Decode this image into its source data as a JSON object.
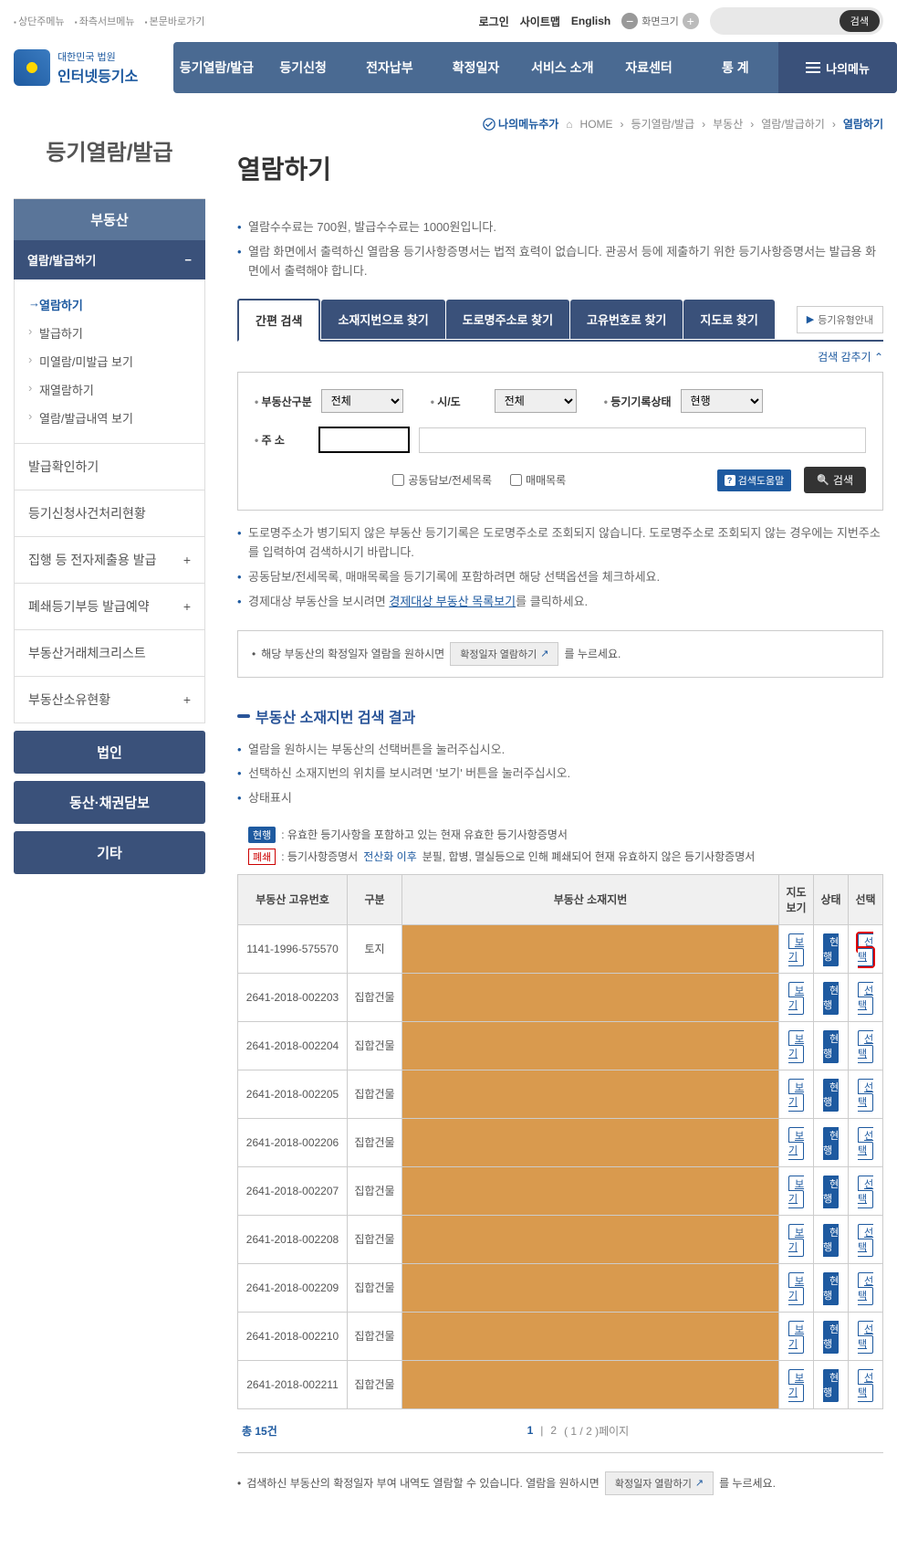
{
  "topLinks": [
    "상단주메뉴",
    "좌측서브메뉴",
    "본문바로가기"
  ],
  "topRight": {
    "login": "로그인",
    "sitemap": "사이트맵",
    "english": "English",
    "zoom": "화면크기",
    "search": "검색"
  },
  "logo": {
    "small": "대한민국 법원",
    "big": "인터넷등기소"
  },
  "nav": [
    "등기열람/발급",
    "등기신청",
    "전자납부",
    "확정일자",
    "서비스 소개",
    "자료센터",
    "통 계"
  ],
  "myMenu": "나의메뉴",
  "sidebar": {
    "title": "등기열람/발급",
    "cat": "부동산",
    "sub": "열람/발급하기",
    "items": [
      "열람하기",
      "발급하기",
      "미열람/미발급 보기",
      "재열람하기",
      "열람/발급내역 보기"
    ],
    "below": [
      "발급확인하기",
      "등기신청사건처리현황",
      "집행 등 전자제출용 발급",
      "폐쇄등기부등 발급예약",
      "부동산거래체크리스트",
      "부동산소유현황"
    ],
    "buttons": [
      "법인",
      "동산·채권담보",
      "기타"
    ]
  },
  "breadcrumb": {
    "add": "나의메뉴추가",
    "home": "HOME",
    "parts": [
      "등기열람/발급",
      "부동산",
      "열람/발급하기",
      "열람하기"
    ]
  },
  "pageTitle": "열람하기",
  "notice": [
    "열람수수료는 700원, 발급수수료는 1000원입니다.",
    "열람 화면에서 출력하신 열람용 등기사항증명서는 법적 효력이 없습니다. 관공서 등에 제출하기 위한 등기사항증명서는 발급용 화면에서 출력해야 합니다."
  ],
  "tabs": [
    "간편 검색",
    "소재지번으로 찾기",
    "도로명주소로 찾기",
    "고유번호로 찾기",
    "지도로 찾기"
  ],
  "typeGuide": "등기유형안내",
  "hideSearch": "검색 감추기",
  "form": {
    "labels": {
      "type": "부동산구분",
      "sido": "시/도",
      "status": "등기기록상태",
      "addr": "주 소"
    },
    "opts": {
      "all": "전체",
      "current": "현행"
    },
    "chk1": "공동담보/전세목록",
    "chk2": "매매목록",
    "help": "검색도움말",
    "search": "검색"
  },
  "hints": [
    "도로명주소가 병기되지 않은 부동산 등기기록은 도로명주소로 조회되지 않습니다. 도로명주소로 조회되지 않는 경우에는 지번주소를 입력하여 검색하시기 바랍니다.",
    "공동담보/전세목록, 매매목록을 등기기록에 포함하려면 해당 선택옵션을 체크하세요.",
    "경제대상 부동산을 보시려면 "
  ],
  "hintLink": "경제대상 부동산 목록보기",
  "hintLinkAfter": "를 클릭하세요.",
  "infoBox1": {
    "pre": "해당 부동산의 확정일자 열람을 원하시면",
    "btn": "확정일자 열람하기",
    "post": "를 누르세요."
  },
  "resultTitle": "부동산 소재지번 검색 결과",
  "resultHints": [
    "열람을 원하시는 부동산의 선택버튼을 눌러주십시오.",
    "선택하신 소재지번의 위치를 보시려면 '보기' 버튼을 눌러주십시오.",
    "상태표시"
  ],
  "statusDesc": {
    "current": ": 유효한 등기사항을 포함하고 있는 현재 유효한 등기사항증명서",
    "closedPre": ": 등기사항증명서 ",
    "closedMid": "전산화 이후",
    "closedPost": " 분필, 합병, 멸실등으로 인해 폐쇄되어 현재 유효하지 않은 등기사항증명서"
  },
  "badges": {
    "current": "현행",
    "closed": "폐쇄"
  },
  "table": {
    "headers": [
      "부동산 고유번호",
      "구분",
      "부동산 소재지번",
      "지도\n보기",
      "상태",
      "선택"
    ],
    "viewBtn": "보기",
    "selectBtn": "선택",
    "rows": [
      {
        "id": "1141-1996-575570",
        "type": "토지"
      },
      {
        "id": "2641-2018-002203",
        "type": "집합건물"
      },
      {
        "id": "2641-2018-002204",
        "type": "집합건물"
      },
      {
        "id": "2641-2018-002205",
        "type": "집합건물"
      },
      {
        "id": "2641-2018-002206",
        "type": "집합건물"
      },
      {
        "id": "2641-2018-002207",
        "type": "집합건물"
      },
      {
        "id": "2641-2018-002208",
        "type": "집합건물"
      },
      {
        "id": "2641-2018-002209",
        "type": "집합건물"
      },
      {
        "id": "2641-2018-002210",
        "type": "집합건물"
      },
      {
        "id": "2641-2018-002211",
        "type": "집합건물"
      }
    ]
  },
  "pagination": {
    "total": "총 15건",
    "pages": [
      "1",
      "2"
    ],
    "suffix": "( 1 / 2 )페이지"
  },
  "infoBox2": {
    "pre": "검색하신 부동산의 확정일자 부여 내역도 열람할 수 있습니다. 열람을 원하시면",
    "btn": "확정일자 열람하기",
    "post": "를 누르세요."
  }
}
